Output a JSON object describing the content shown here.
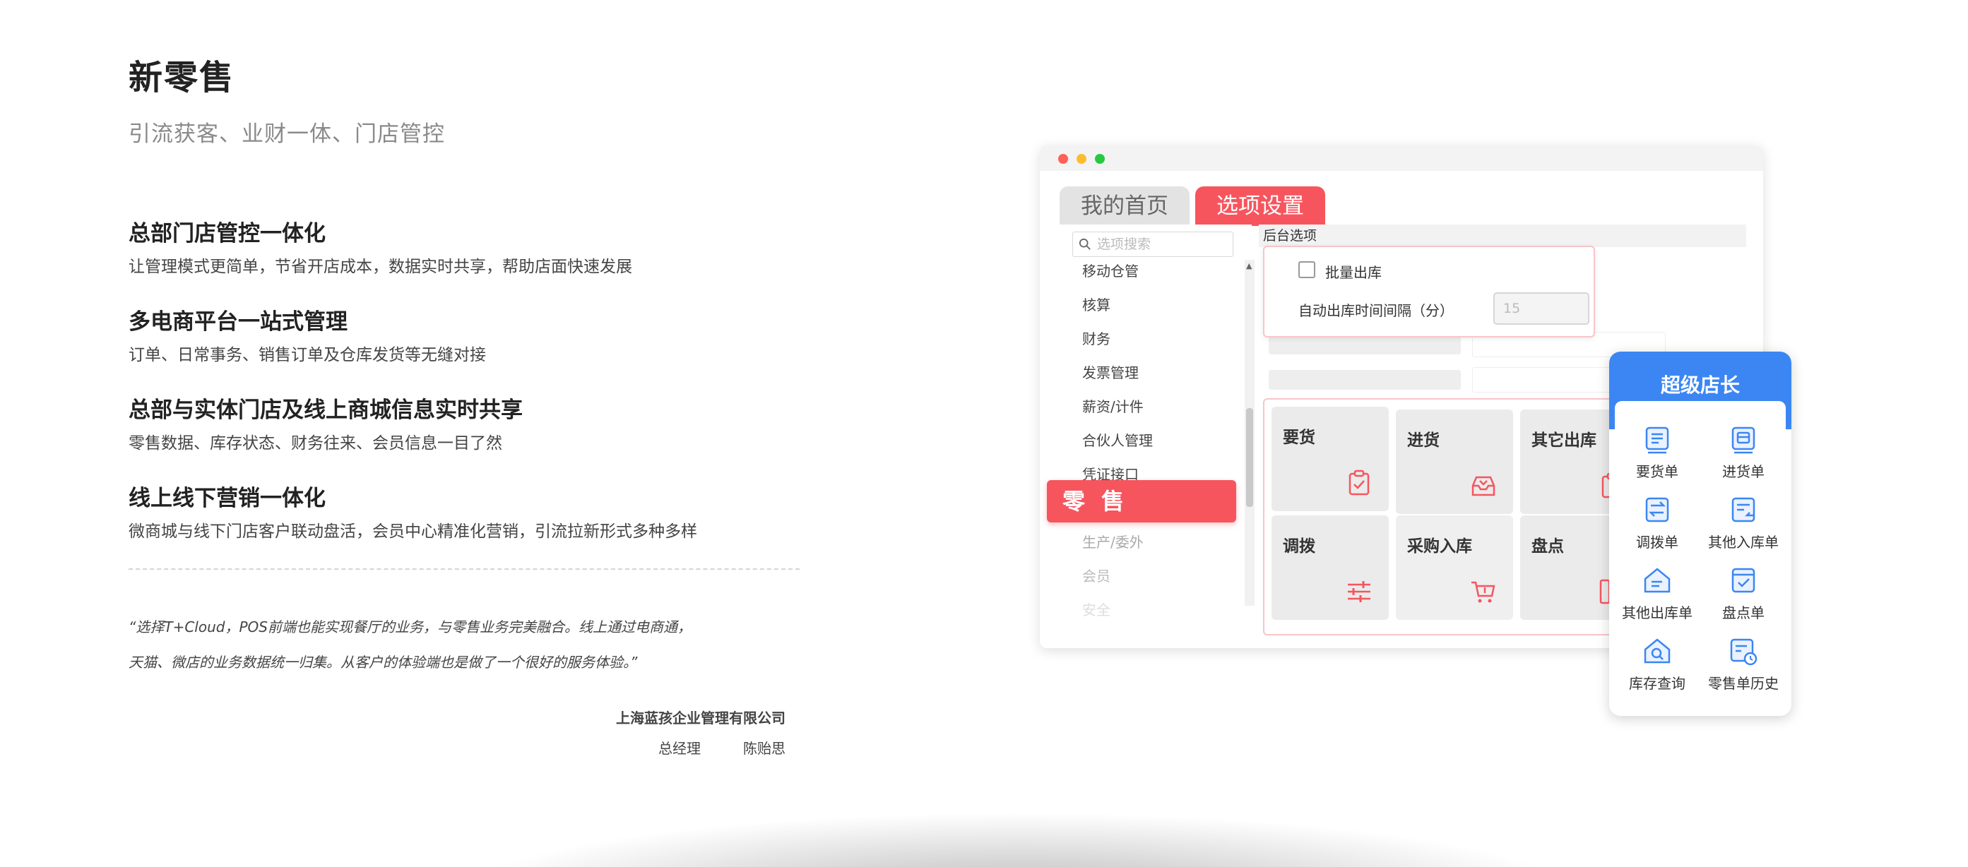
{
  "header": {
    "title": "新零售",
    "subtitle": "引流获客、业财一体、门店管控"
  },
  "features": [
    {
      "title": "总部门店管控一体化",
      "desc": "让管理模式更简单，节省开店成本，数据实时共享，帮助店面快速发展"
    },
    {
      "title": "多电商平台一站式管理",
      "desc": "订单、日常事务、销售订单及仓库发货等无缝对接"
    },
    {
      "title": "总部与实体门店及线上商城信息实时共享",
      "desc": "零售数据、库存状态、财务往来、会员信息一目了然"
    },
    {
      "title": "线上线下营销一体化",
      "desc": "微商城与线下门店客户联动盘活，会员中心精准化营销，引流拉新形式多种多样"
    }
  ],
  "testimonial": {
    "line1": "“选择T+Cloud，POS前端也能实现餐厅的业务，与零售业务完美融合。线上通过电商通，",
    "line2": "天猫、微店的业务数据统一归集。从客户的体验端也是做了一个很好的服务体验。”",
    "company": "上海蓝孩企业管理有限公司",
    "role": "总经理",
    "name": "陈贻思"
  },
  "window": {
    "tabs": {
      "home": "我的首页",
      "settings": "选项设置"
    },
    "search_placeholder": "选项搜索",
    "menu": [
      "移动仓管",
      "核算",
      "财务",
      "发票管理",
      "薪资/计件",
      "合伙人管理",
      "凭证接口",
      "零售",
      "生产/委外",
      "会员",
      "安全"
    ],
    "retail_label": "零 售",
    "content_header": "后台选项",
    "option_checkbox_label": "批量出库",
    "option_interval_label": "自动出库时间间隔（分）",
    "option_interval_value": "15",
    "tiles": [
      {
        "label": "要货",
        "icon": "clipboard-check-icon"
      },
      {
        "label": "进货",
        "icon": "inbox-tray-icon"
      },
      {
        "label": "其它出库",
        "icon": "clipboard-out-icon"
      },
      {
        "label": "调拨",
        "icon": "sliders-icon"
      },
      {
        "label": "采购入库",
        "icon": "cart-icon"
      },
      {
        "label": "盘点",
        "icon": "columns-icon"
      }
    ],
    "accent_color": "#f7555e"
  },
  "mobile": {
    "title": "超级店长",
    "accent_color": "#3b86f3",
    "items": [
      {
        "label": "要货单",
        "icon": "list-doc-icon"
      },
      {
        "label": "进货单",
        "icon": "box-doc-icon"
      },
      {
        "label": "调拨单",
        "icon": "transfer-doc-icon"
      },
      {
        "label": "其他入库单",
        "icon": "import-doc-icon"
      },
      {
        "label": "其他出库单",
        "icon": "export-house-icon"
      },
      {
        "label": "盘点单",
        "icon": "check-doc-icon"
      },
      {
        "label": "库存查询",
        "icon": "house-search-icon"
      },
      {
        "label": "零售单历史",
        "icon": "history-doc-icon"
      }
    ]
  }
}
